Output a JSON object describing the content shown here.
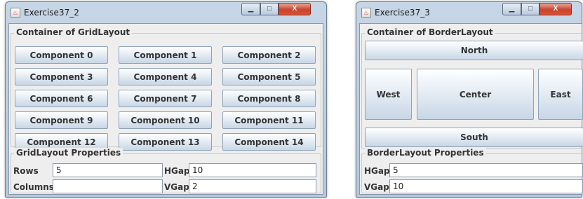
{
  "window1": {
    "title": "Exercise37_2",
    "grid_panel_title": "Container of GridLayout",
    "buttons": [
      "Component 0",
      "Component 1",
      "Component 2",
      "Component 3",
      "Component 4",
      "Component 5",
      "Component 6",
      "Component 7",
      "Component 8",
      "Component 9",
      "Component 10",
      "Component 11",
      "Component 12",
      "Component 13",
      "Component 14"
    ],
    "properties": {
      "title": "GridLayout Properties",
      "rows_label": "Rows",
      "rows_value": "5",
      "columns_label": "Columns",
      "columns_value": "",
      "hgap_label": "HGap",
      "hgap_value": "10",
      "vgap_label": "VGap",
      "vgap_value": "2"
    }
  },
  "window2": {
    "title": "Exercise37_3",
    "border_panel_title": "Container of BorderLayout",
    "north": "North",
    "west": "West",
    "center": "Center",
    "east": "East",
    "south": "South",
    "properties": {
      "title": "BorderLayout Properties",
      "hgap_label": "HGap",
      "hgap_value": "5",
      "vgap_label": "VGap",
      "vgap_value": "10"
    }
  },
  "caption_buttons": {
    "minimize": "▁",
    "maximize": "□",
    "close": "X"
  },
  "colors": {
    "titlebar": "#b4c7dc",
    "content": "#eeeeee",
    "close_button": "#c9432c"
  }
}
